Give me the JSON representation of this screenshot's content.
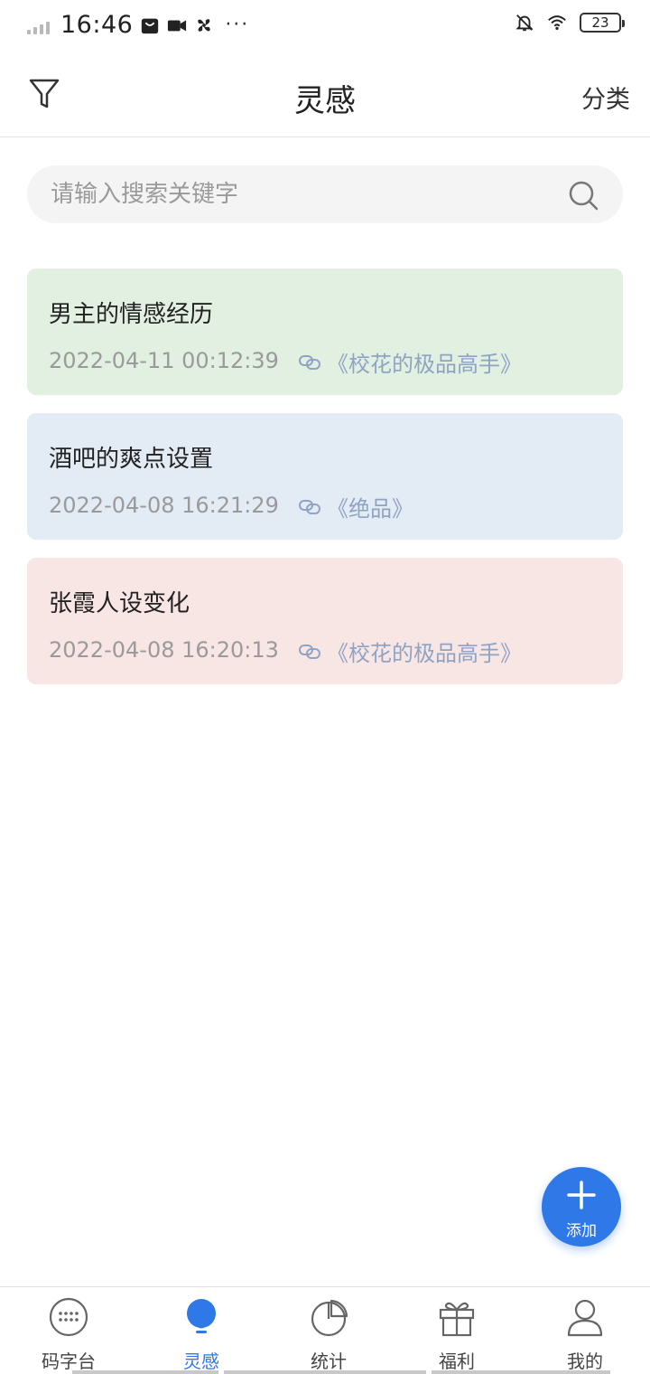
{
  "status_bar": {
    "time": "16:46",
    "battery": "23"
  },
  "header": {
    "title": "灵感",
    "filter_icon": "filter-icon",
    "category_label": "分类"
  },
  "search": {
    "placeholder": "请输入搜索关键字",
    "icon": "search-icon"
  },
  "cards": [
    {
      "title": "男主的情感经历",
      "date": "2022-04-11 00:12:39",
      "book": "《校花的极品高手》",
      "color": "#e1f0e1"
    },
    {
      "title": "酒吧的爽点设置",
      "date": "2022-04-08 16:21:29",
      "book": "《绝品》",
      "color": "#e3ebf4"
    },
    {
      "title": "张霞人设变化",
      "date": "2022-04-08 16:20:13",
      "book": "《校花的极品高手》",
      "color": "#f8e6e5"
    }
  ],
  "fab": {
    "label": "添加",
    "color": "#2f78e8"
  },
  "tabbar": {
    "items": [
      {
        "label": "码字台",
        "icon": "keyboard-icon"
      },
      {
        "label": "灵感",
        "icon": "lightbulb-icon",
        "active": true
      },
      {
        "label": "统计",
        "icon": "pie-chart-icon"
      },
      {
        "label": "福利",
        "icon": "gift-icon"
      },
      {
        "label": "我的",
        "icon": "user-icon"
      }
    ],
    "active_color": "#2f78e8"
  }
}
